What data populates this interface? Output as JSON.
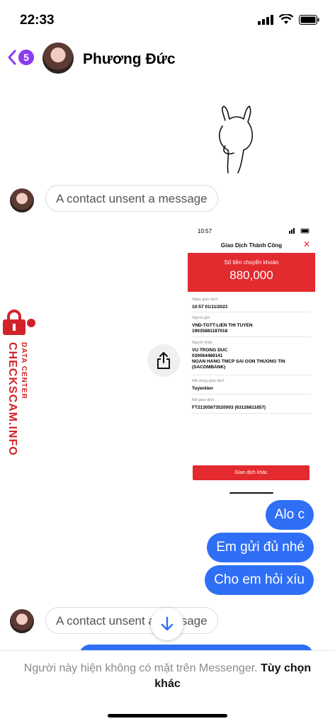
{
  "status": {
    "time": "22:33"
  },
  "header": {
    "back_badge": "5",
    "contact_name": "Phương Đức"
  },
  "messages": {
    "unsent_1": "A contact unsent a message",
    "unsent_2": "A contact unsent a message",
    "sent": [
      "Alo c",
      "Em gửi đủ nhé",
      "Cho em hỏi xíu"
    ]
  },
  "receipt": {
    "time": "10:57",
    "title": "Giao Dịch Thành Công",
    "amount_label": "Số tiền chuyển khoản",
    "amount": "880,000",
    "date_label": "Ngày giao dịch",
    "date": "10:57 01/11/2021",
    "sender_label": "Người gửi",
    "sender": "VND-TGTT-LIEN THI TUYEN",
    "sender_acct": "19035881187018",
    "receiver_label": "Người nhận",
    "receiver": "VU TRONG DUC",
    "receiver_acct": "030064489141",
    "receiver_bank": "NGAN HANG TMCP SAI GON THUONG TIN (SACOMBANK)",
    "note_label": "Nội dung giao dịch",
    "note": "Tuyenlien",
    "code_label": "Mã giao dịch",
    "code": "FT21305673520003 (63126811857)",
    "button": "Giao dịch khác"
  },
  "watermark": {
    "brand": "CHECKSCAM.INFO",
    "sub": "DATA CENTER"
  },
  "footer": {
    "text": "Người này hiện không có mặt trên Messenger.",
    "link": "Tùy chọn khác"
  },
  "colors": {
    "accent": "#2f6ff5",
    "badge": "#8b3cf0",
    "receipt_red": "#e32a2f"
  }
}
